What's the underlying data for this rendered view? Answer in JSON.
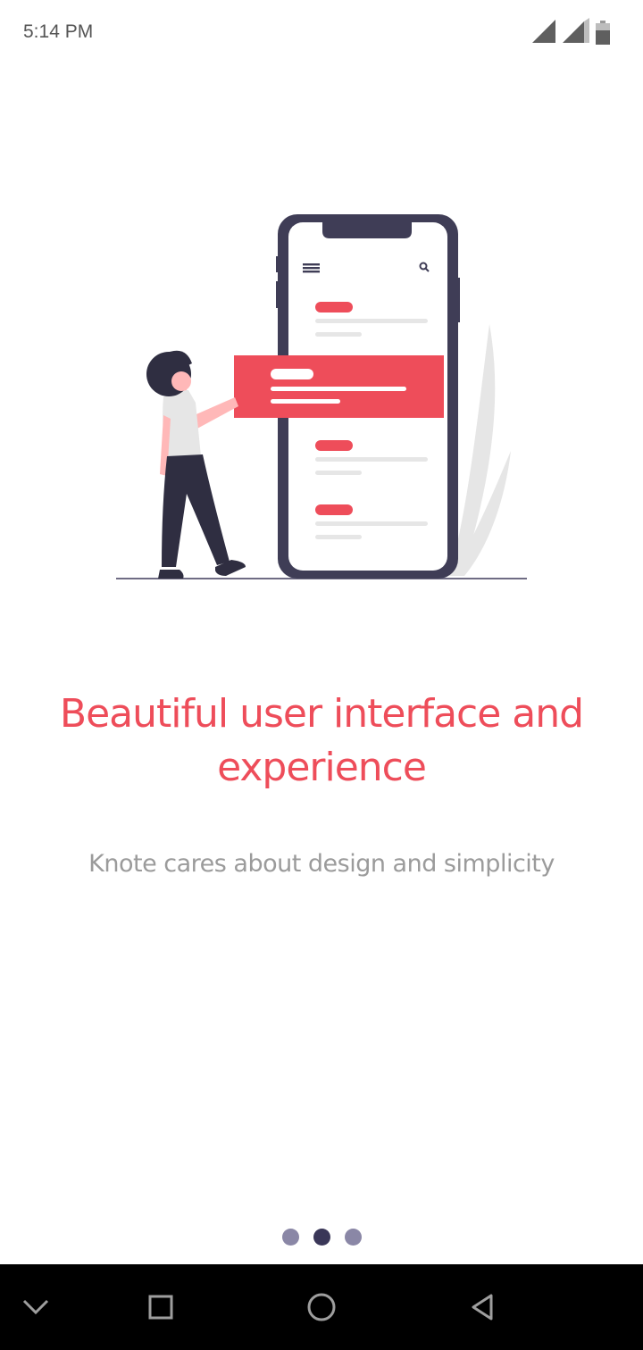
{
  "status_bar": {
    "time": "5:14 PM",
    "icons": [
      "signal-icon",
      "signal-icon",
      "battery-icon"
    ]
  },
  "onboarding": {
    "title": "Beautiful user interface and experience",
    "subtitle": "Knote cares about design and simplicity",
    "page_count": 3,
    "current_page": 2
  },
  "nav_bar": {
    "buttons": [
      "chevron-down-icon",
      "recents-square-icon",
      "home-circle-icon",
      "back-triangle-icon"
    ]
  },
  "colors": {
    "accent": "#ee4d5a",
    "dark": "#3a3758",
    "muted_dot": "#8a87a6",
    "subtitle": "#9b9b9b"
  }
}
